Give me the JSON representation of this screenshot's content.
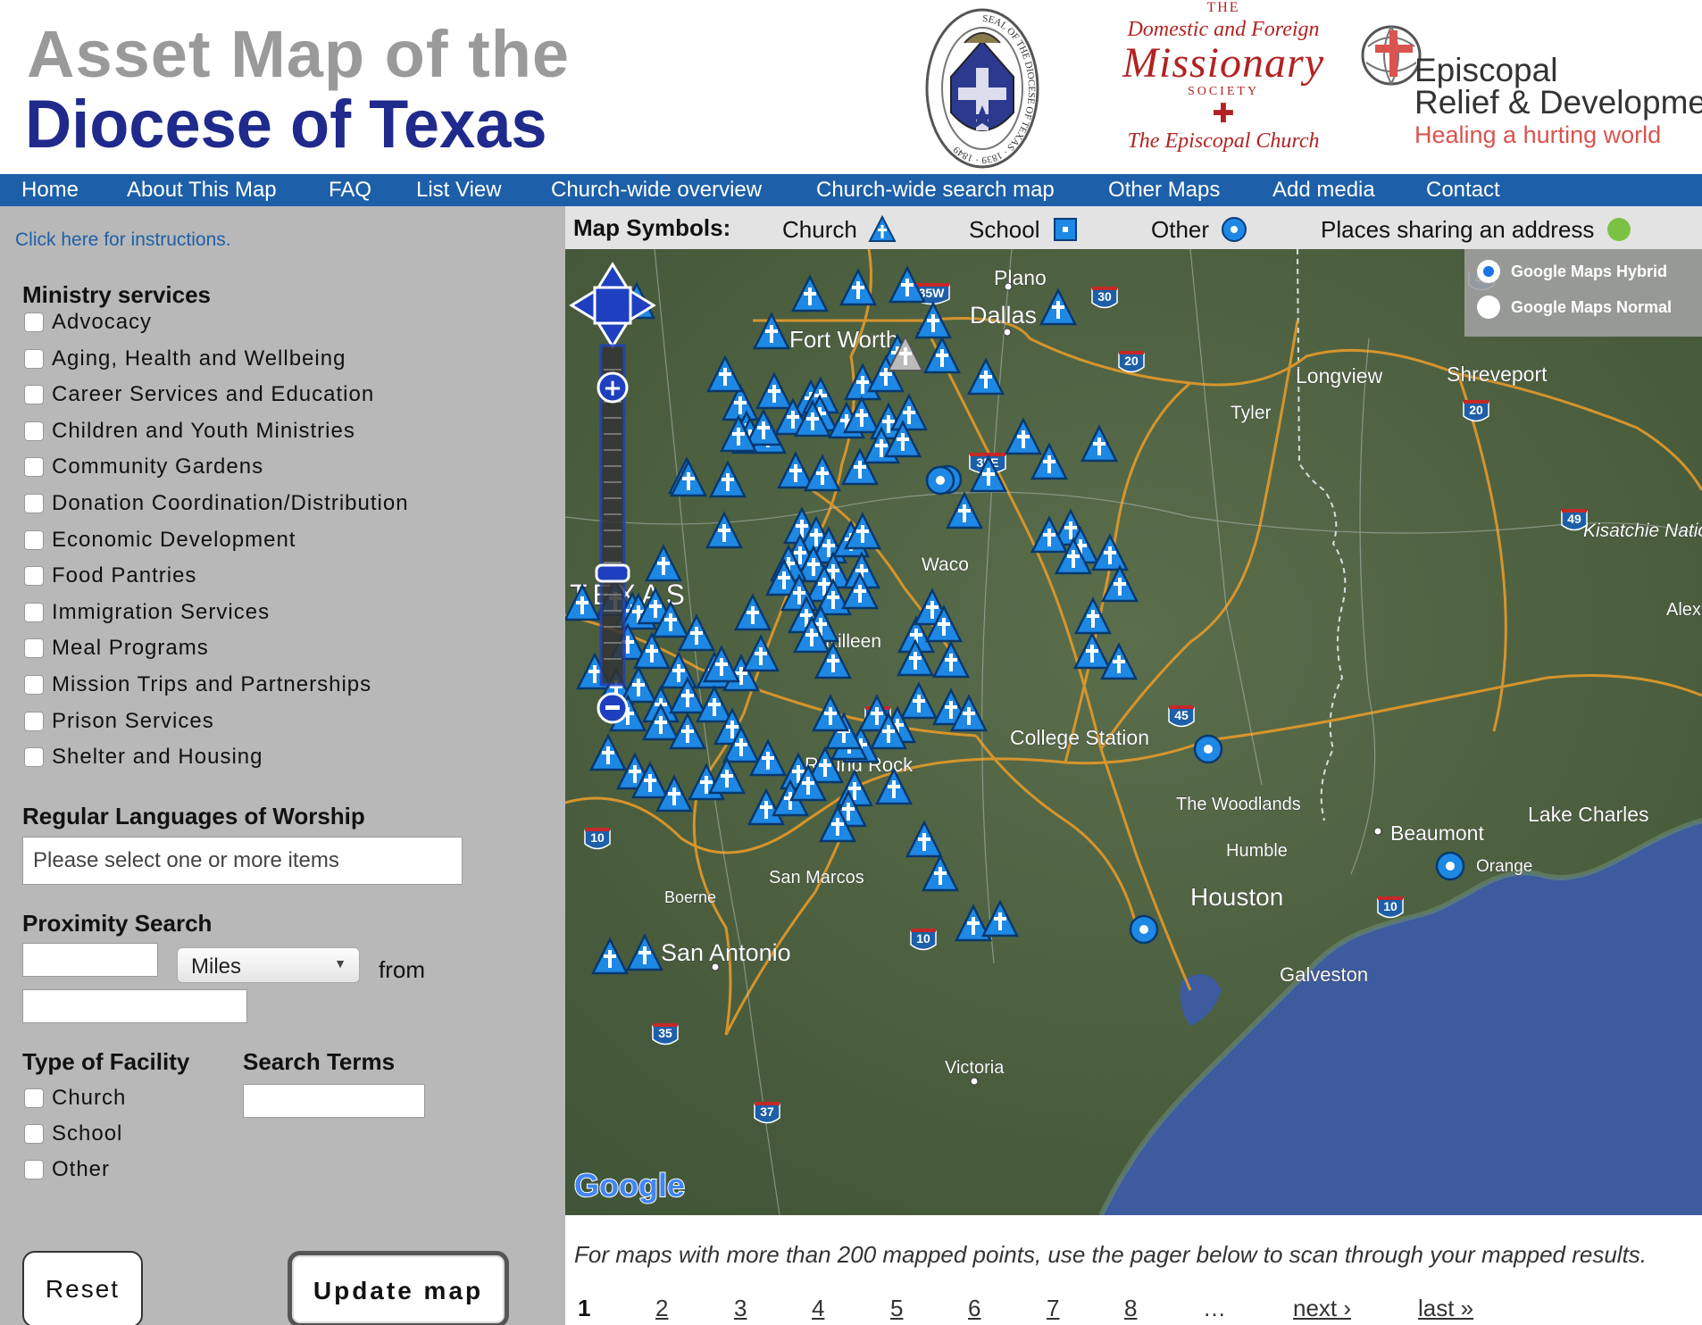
{
  "header": {
    "title_line1": "Asset Map of the",
    "title_line2": "Diocese of Texas",
    "seal_text": "SEAL OF THE DIOCESE OF TEXAS · 1839 · 1849",
    "dfms": {
      "the": "THE",
      "domestic_foreign": "Domestic and Foreign",
      "missionary": "Missionary",
      "society": "SOCIETY",
      "church": "The Episcopal Church"
    },
    "erd": {
      "line1": "Episcopal",
      "line2": "Relief & Development",
      "tagline": "Healing a hurting world"
    }
  },
  "nav": {
    "items": [
      {
        "label": "Home"
      },
      {
        "label": "About This Map"
      },
      {
        "label": "FAQ"
      },
      {
        "label": "List View"
      },
      {
        "label": "Church-wide overview"
      },
      {
        "label": "Church-wide search map"
      },
      {
        "label": "Other Maps"
      },
      {
        "label": "Add media"
      },
      {
        "label": "Contact"
      }
    ]
  },
  "sidebar": {
    "instructions": "Click here for instructions.",
    "ministry_heading": "Ministry services",
    "ministry_services": [
      "Advocacy",
      "Aging, Health and Wellbeing",
      "Career Services and Education",
      "Children and Youth Ministries",
      "Community Gardens",
      "Donation Coordination/Distribution",
      "Economic Development",
      "Food Pantries",
      "Immigration Services",
      "Meal Programs",
      "Mission Trips and Partnerships",
      "Prison Services",
      "Shelter and Housing"
    ],
    "languages_heading": "Regular Languages of Worship",
    "languages_placeholder": "Please select one or more items",
    "proximity_heading": "Proximity Search",
    "proximity_unit": "Miles",
    "proximity_from": "from",
    "facility_heading": "Type of Facility",
    "facility_types": [
      "Church",
      "School",
      "Other"
    ],
    "search_terms_heading": "Search Terms",
    "reset_label": "Reset",
    "update_label": "Update map"
  },
  "legend": {
    "title": "Map Symbols:",
    "church": "Church",
    "school": "School",
    "other": "Other",
    "shared": "Places sharing an address",
    "colors": {
      "marker": "#1e88e5",
      "shared": "#7cc242"
    }
  },
  "map": {
    "type_options": [
      {
        "label": "Google Maps Hybrid",
        "selected": true
      },
      {
        "label": "Google Maps Normal",
        "selected": false
      }
    ],
    "region_label": "TEXAS",
    "google_logo": "Google",
    "cities": {
      "plano": "Plano",
      "dallas": "Dallas",
      "fortworth": "Fort Worth",
      "longview": "Longview",
      "shreveport": "Shreveport",
      "tyler": "Tyler",
      "waco": "Waco",
      "killeen": "Killeen",
      "college_station": "College Station",
      "round_rock": "Round Rock",
      "woodlands": "The Woodlands",
      "humble": "Humble",
      "houston": "Houston",
      "beaumont": "Beaumont",
      "orange": "Orange",
      "lake_charles": "Lake Charles",
      "boerne": "Boerne",
      "san_marcos": "San Marcos",
      "san_antonio": "San Antonio",
      "galveston": "Galveston",
      "victoria": "Victoria",
      "kisatchie": "Kisatchie National",
      "alex": "Alex"
    },
    "highways": {
      "h35w": "35W",
      "h30": "30",
      "h20a": "20",
      "h20b": "20",
      "h49a": "49",
      "h49b": "49",
      "h35e": "35E",
      "h35a": "35",
      "h45": "45",
      "h10a": "10",
      "h10b": "10",
      "h10c": "10",
      "h35b": "35",
      "h37": "37"
    }
  },
  "pager": {
    "note": "For maps with more than 200 mapped points, use the pager below to scan through your mapped results.",
    "pages": [
      "1",
      "2",
      "3",
      "4",
      "5",
      "6",
      "7",
      "8"
    ],
    "ellipsis": "…",
    "next": "next ›",
    "last": "last »"
  }
}
